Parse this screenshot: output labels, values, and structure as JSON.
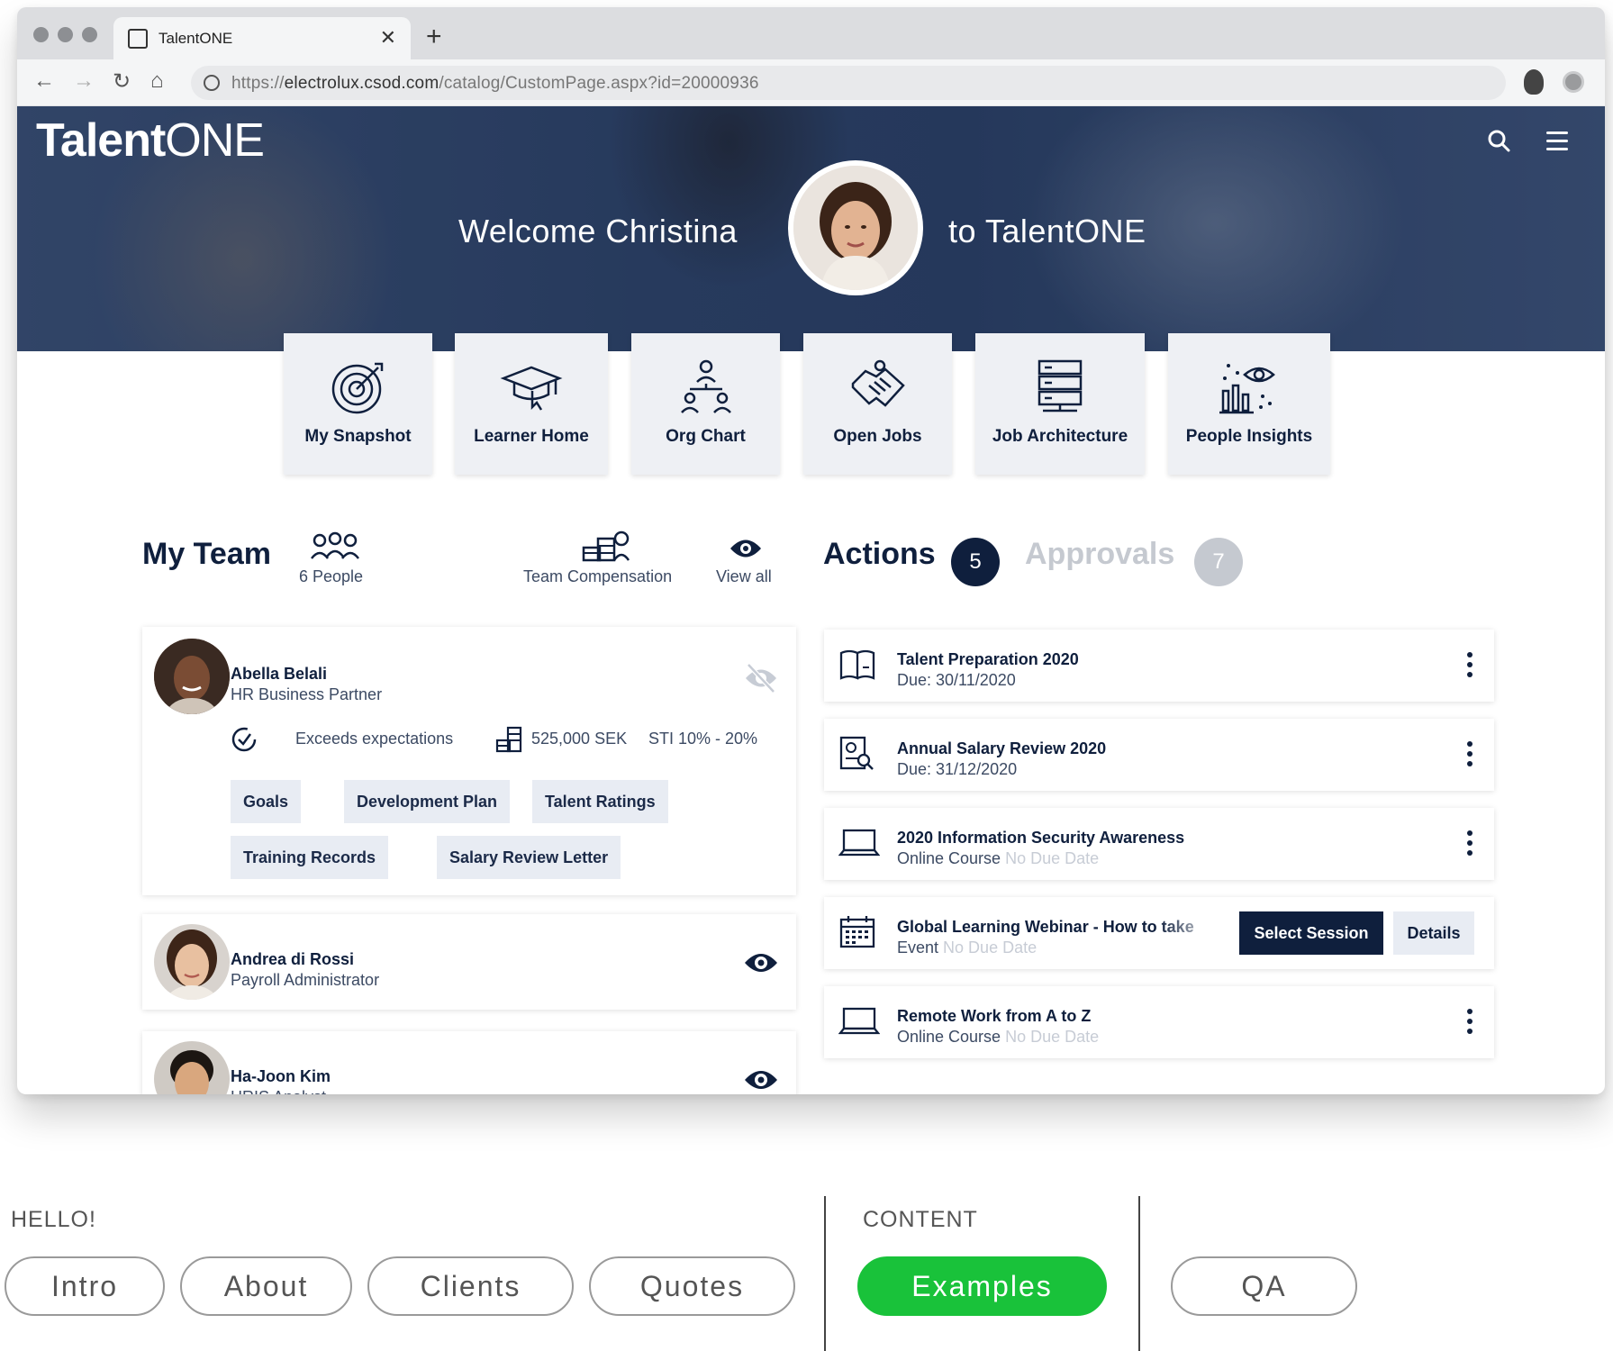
{
  "browser": {
    "tab_title": "TalentONE",
    "url_prefix": "https://",
    "url_domain": "electrolux.csod.com",
    "url_path": "/catalog/CustomPage.aspx?id=20000936"
  },
  "hero": {
    "brand_bold": "Talent",
    "brand_light": "ONE",
    "welcome_left": "Welcome Christina",
    "welcome_right": "to TalentONE"
  },
  "tiles": [
    {
      "label": "My Snapshot",
      "icon": "target-icon"
    },
    {
      "label": "Learner Home",
      "icon": "graduation-cap-icon"
    },
    {
      "label": "Org Chart",
      "icon": "org-chart-icon"
    },
    {
      "label": "Open Jobs",
      "icon": "handshake-icon"
    },
    {
      "label": "Job Architecture",
      "icon": "server-stack-icon"
    },
    {
      "label": "People Insights",
      "icon": "insights-icon"
    }
  ],
  "my_team": {
    "title": "My Team",
    "people_count": "6 People",
    "compensation_label": "Team Compensation",
    "view_all_label": "View all",
    "members": [
      {
        "name": "Abella Belali",
        "role": "HR Business Partner",
        "rating": "Exceeds expectations",
        "salary": "525,000 SEK",
        "sti": "STI 10% - 20%",
        "chips": [
          "Goals",
          "Development Plan",
          "Talent Ratings",
          "Training Records",
          "Salary Review Letter"
        ]
      },
      {
        "name": "Andrea di Rossi",
        "role": "Payroll Administrator"
      },
      {
        "name": "Ha-Joon Kim",
        "role": "HRIS Analyst"
      }
    ]
  },
  "actions": {
    "title": "Actions",
    "count": "5",
    "approvals_title": "Approvals",
    "approvals_count": "7",
    "items": [
      {
        "title": "Talent Preparation 2020",
        "sub": "Due: 30/11/2020",
        "muted": "",
        "icon": "book-icon"
      },
      {
        "title": "Annual Salary Review 2020",
        "sub": "Due: 31/12/2020",
        "muted": "",
        "icon": "document-search-icon"
      },
      {
        "title": "2020 Information Security Awareness",
        "sub": "Online Course",
        "muted": "No Due Date",
        "icon": "laptop-icon"
      },
      {
        "title": "Global Learning Webinar - How to take",
        "sub": "Event",
        "muted": "No Due Date",
        "icon": "calendar-icon",
        "primary_button": "Select Session",
        "secondary_button": "Details"
      },
      {
        "title": "Remote Work from A to Z",
        "sub": "Online Course",
        "muted": "No Due Date",
        "icon": "laptop-icon"
      }
    ]
  },
  "bottom_nav": {
    "hello_label": "HELLO!",
    "content_label": "CONTENT",
    "pills": [
      "Intro",
      "About",
      "Clients",
      "Quotes",
      "Examples",
      "QA"
    ],
    "active": "Examples"
  },
  "colors": {
    "navy": "#0f1f3d",
    "chip_bg": "#e8ecf3",
    "active_green": "#19c23a",
    "approvals_gray": "#c5c9d0"
  }
}
